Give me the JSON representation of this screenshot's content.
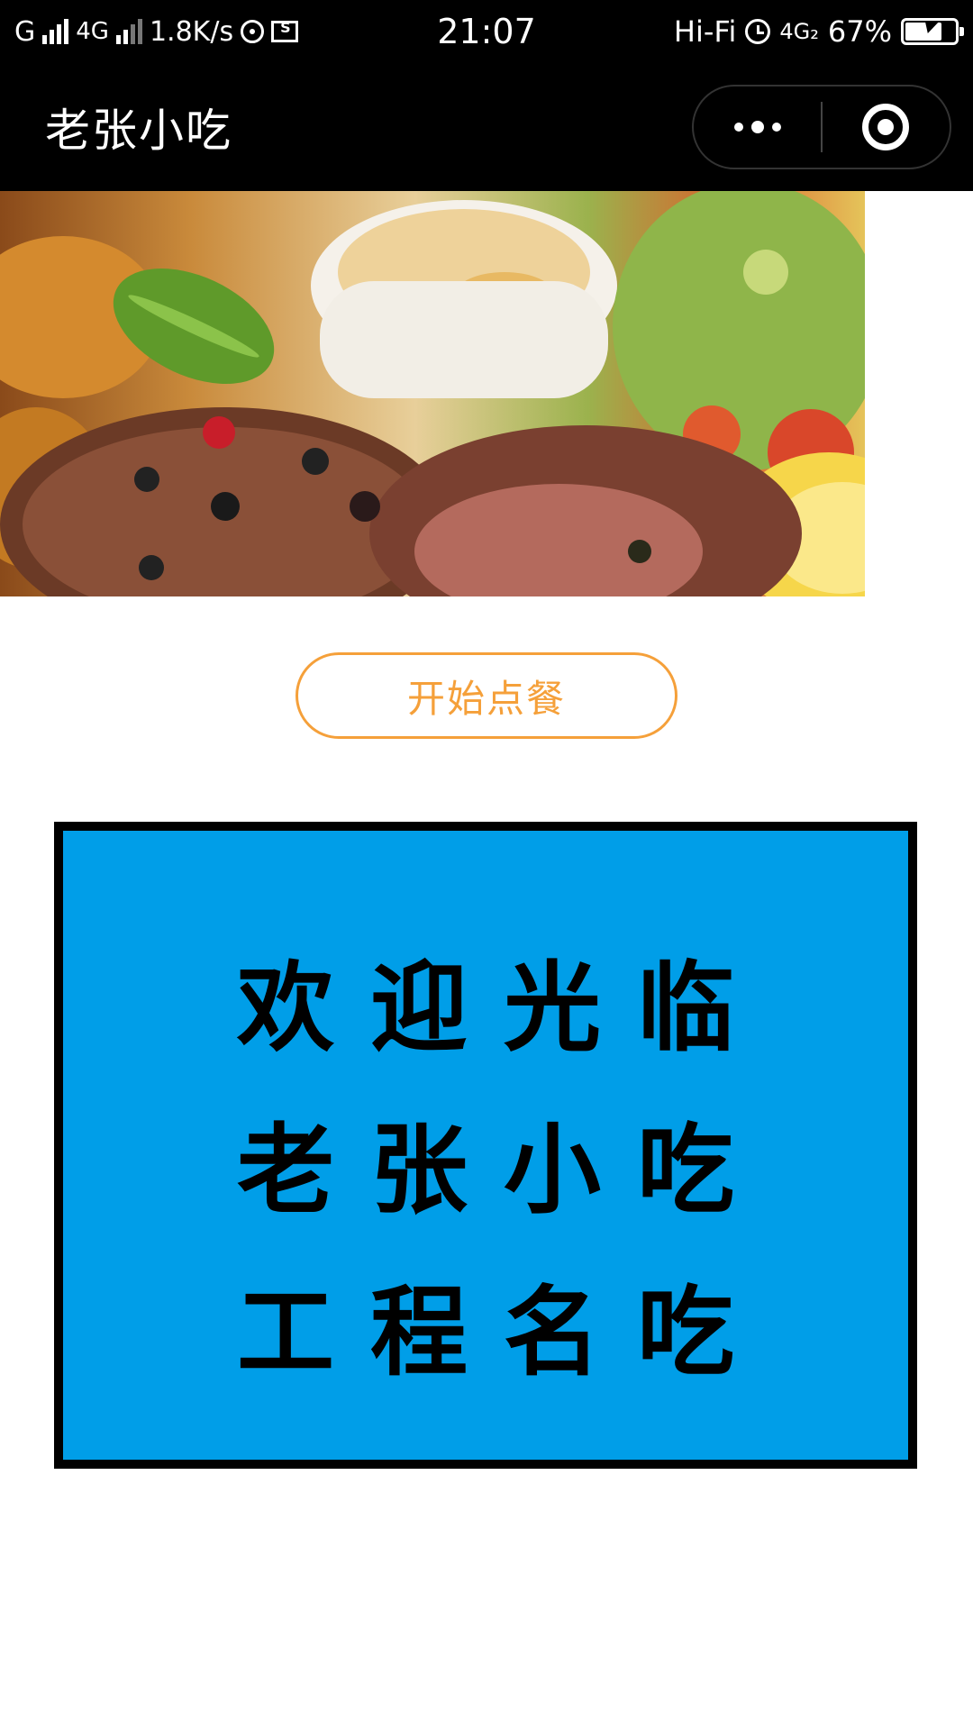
{
  "status_bar": {
    "carrier1": "G",
    "carrier2": "4G",
    "net_speed": "1.8K/s",
    "time": "21:07",
    "hifi": "Hi-Fi",
    "network": "4G₂",
    "battery": "67%"
  },
  "nav": {
    "title": "老张小吃",
    "more_icon": "more-dots-icon",
    "close_icon": "target-close-icon"
  },
  "banner": {
    "image_name": "food-banner-image"
  },
  "main": {
    "order_button_label": "开始点餐"
  },
  "welcome_board": {
    "line1": "欢迎光临",
    "line2": "老张小吃",
    "line3": "工程名吃",
    "background_color": "#009ee8",
    "border_color": "#000000"
  },
  "colors": {
    "accent": "#f5a03a",
    "nav_bg": "#000000"
  }
}
